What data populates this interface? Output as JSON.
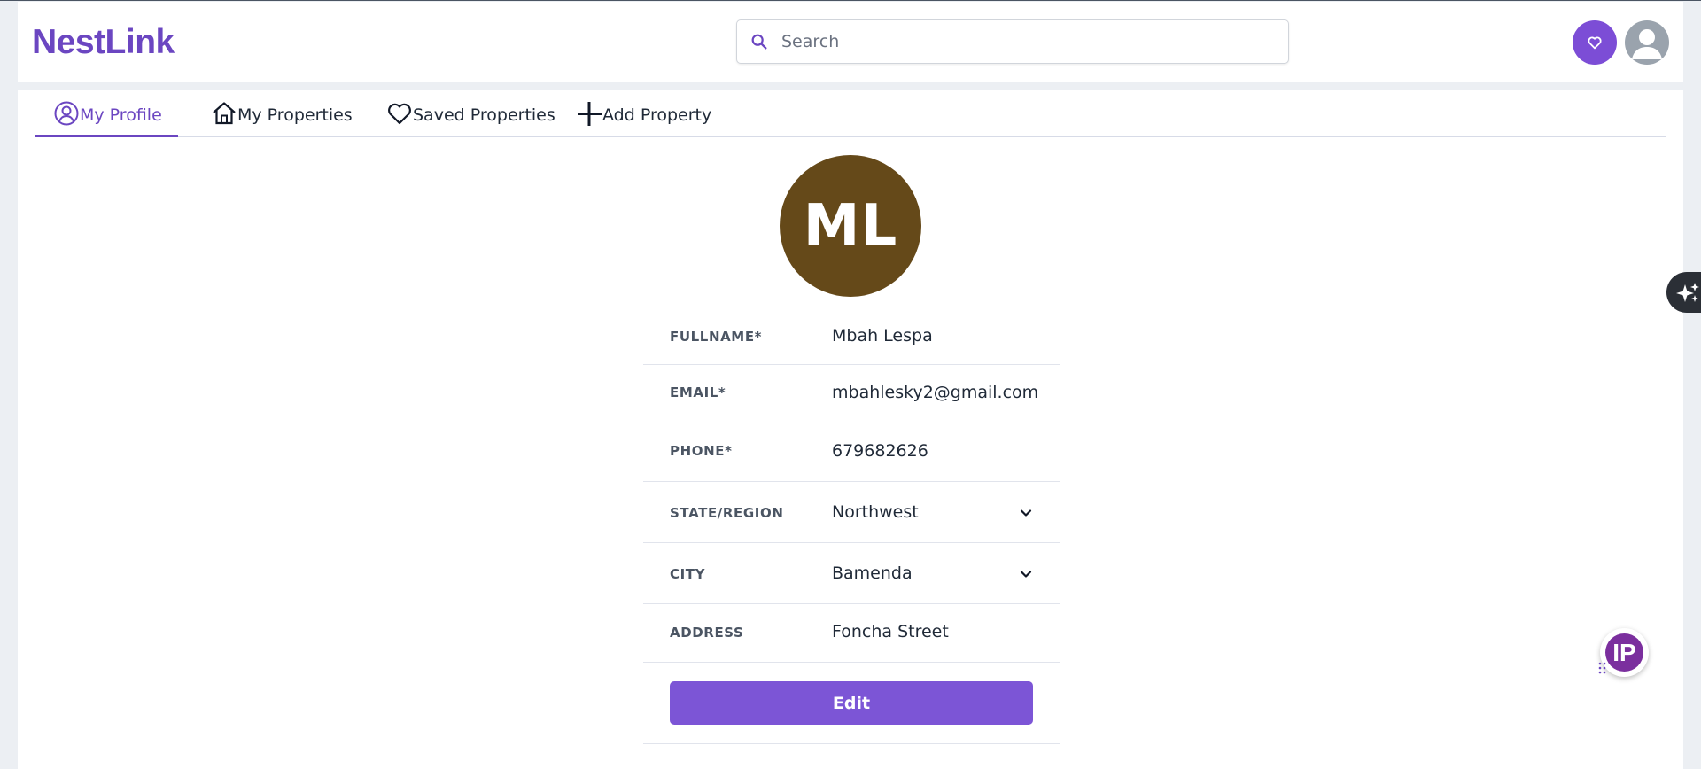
{
  "app": {
    "logo": "NestLink",
    "brand_color": "#6b46c1"
  },
  "search": {
    "placeholder": "Search",
    "value": "",
    "icon": "search-icon"
  },
  "header_actions": [
    {
      "name": "favorites",
      "icon": "heart-icon",
      "color": "#7c4dd6"
    },
    {
      "name": "account",
      "icon": "user-icon",
      "color": "#9aa3ad"
    }
  ],
  "tabs": [
    {
      "label": "My Profile",
      "icon": "user-circle-icon",
      "active": true
    },
    {
      "label": "My Properties",
      "icon": "home-icon",
      "active": false
    },
    {
      "label": "Saved Properties",
      "icon": "heart-icon",
      "active": false
    },
    {
      "label": "Add Property",
      "icon": "plus-icon",
      "active": false
    }
  ],
  "profile": {
    "initials": "ML",
    "avatar_color": "#654919",
    "fields": [
      {
        "label": "FULLNAME*",
        "value": "Mbah Lespa",
        "type": "text"
      },
      {
        "label": "EMAIL*",
        "value": "mbahlesky2@gmail.com",
        "type": "text"
      },
      {
        "label": "PHONE*",
        "value": "679682626",
        "type": "text"
      },
      {
        "label": "STATE/REGION",
        "value": "Northwest",
        "type": "select"
      },
      {
        "label": "CITY",
        "value": "Bamenda",
        "type": "select"
      },
      {
        "label": "ADDRESS",
        "value": "Foncha Street",
        "type": "text"
      }
    ],
    "edit_label": "Edit",
    "edit_color": "#7c55d6"
  },
  "floating": {
    "ai_icon": "sparkles-icon",
    "ip_badge": "IP"
  }
}
